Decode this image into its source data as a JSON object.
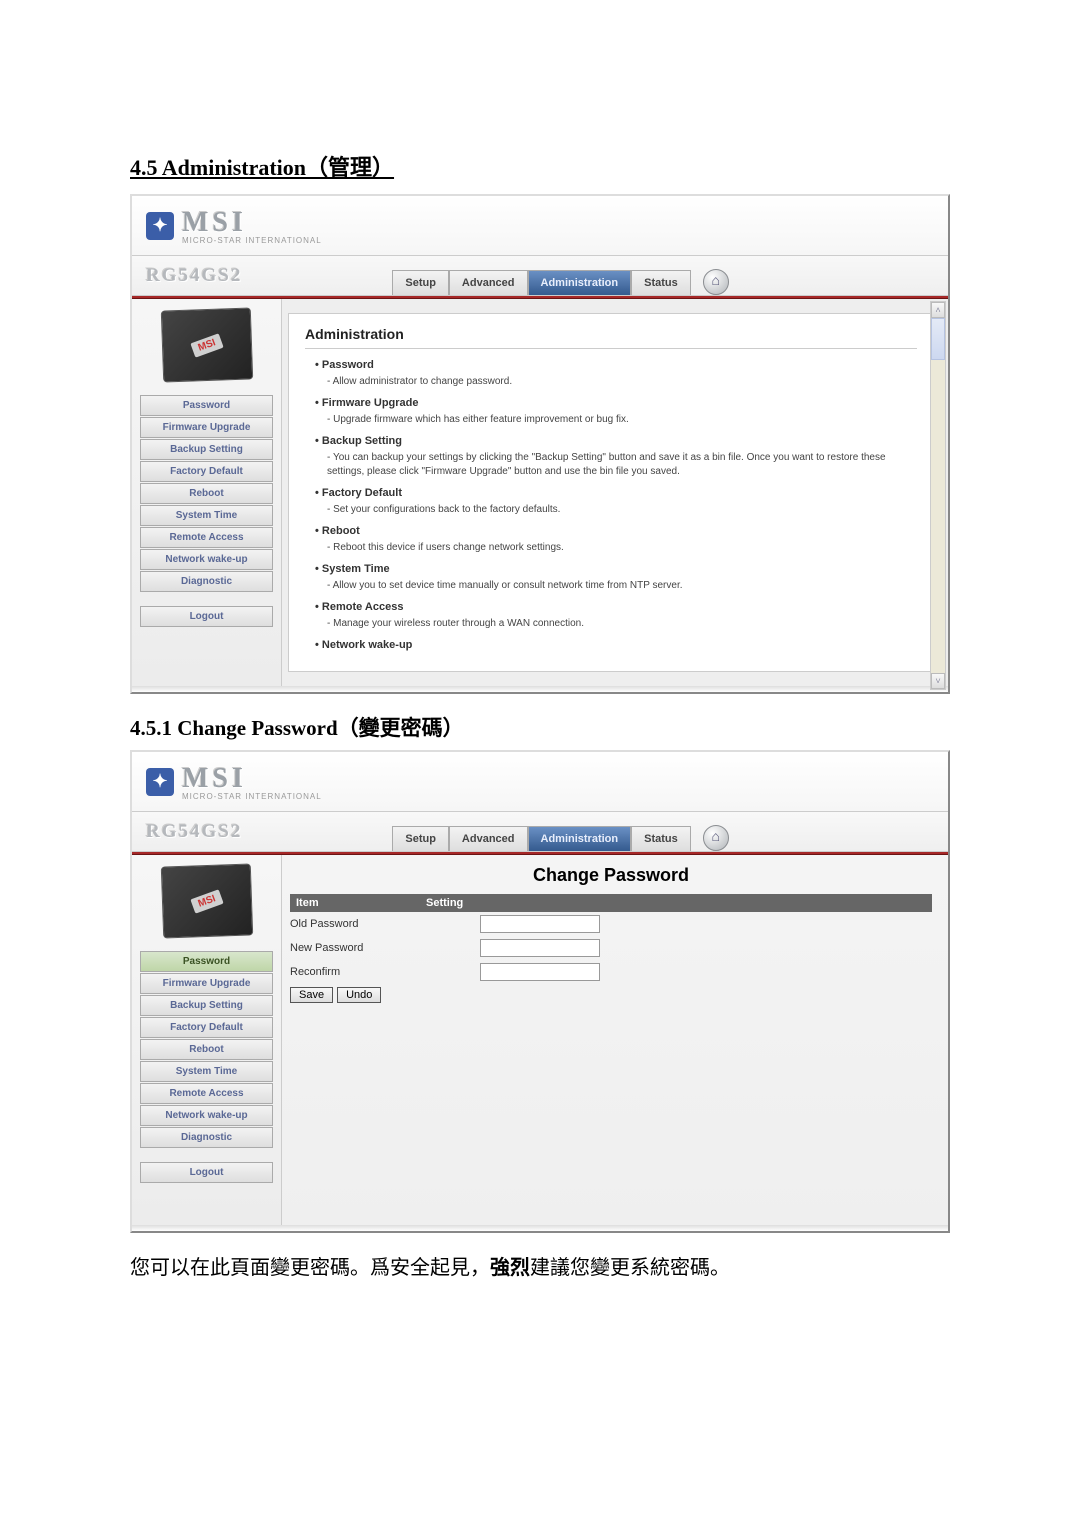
{
  "section_heading": "4.5  Administration（管理）",
  "sub_heading": "4.5.1 Change Password（變更密碼）",
  "footer_note_pre": "您可以在此頁面變更密碼。爲安全起見，",
  "footer_note_bold": "強烈",
  "footer_note_post": "建議您變更系統密碼。",
  "logo": {
    "brand": "MSI",
    "sub": "MICRO-STAR INTERNATIONAL",
    "product": "RG54GS2",
    "mark": "✦"
  },
  "tabs": {
    "setup": "Setup",
    "advanced": "Advanced",
    "administration": "Administration",
    "status": "Status",
    "home_glyph": "⌂"
  },
  "sidebar": {
    "icon_text": "MSI",
    "items": [
      "Password",
      "Firmware Upgrade",
      "Backup Setting",
      "Factory Default",
      "Reboot",
      "System Time",
      "Remote Access",
      "Network wake-up",
      "Diagnostic"
    ],
    "logout": "Logout"
  },
  "admin_panel": {
    "title": "Administration",
    "groups": [
      {
        "name": "Password",
        "desc": "Allow administrator to change password."
      },
      {
        "name": "Firmware Upgrade",
        "desc": "Upgrade firmware which has either feature improvement or bug fix."
      },
      {
        "name": "Backup Setting",
        "desc": "You can backup your settings by clicking the \"Backup Setting\" button and save it as a bin file. Once you want to restore these settings, please click \"Firmware Upgrade\" button and use the bin file you saved."
      },
      {
        "name": "Factory Default",
        "desc": "Set your configurations back to the factory defaults."
      },
      {
        "name": "Reboot",
        "desc": "Reboot this device if users change network settings."
      },
      {
        "name": "System Time",
        "desc": "Allow you to set device time manually or consult network time from NTP server."
      },
      {
        "name": "Remote Access",
        "desc": "Manage your wireless router through a WAN connection."
      },
      {
        "name": "Network wake-up",
        "desc": ""
      }
    ]
  },
  "change_pw": {
    "title": "Change Password",
    "col_item": "Item",
    "col_setting": "Setting",
    "rows": {
      "old": "Old Password",
      "new": "New Password",
      "re": "Reconfirm"
    },
    "btn_save": "Save",
    "btn_undo": "Undo"
  },
  "scroll": {
    "up": "˄",
    "down": "˅"
  }
}
